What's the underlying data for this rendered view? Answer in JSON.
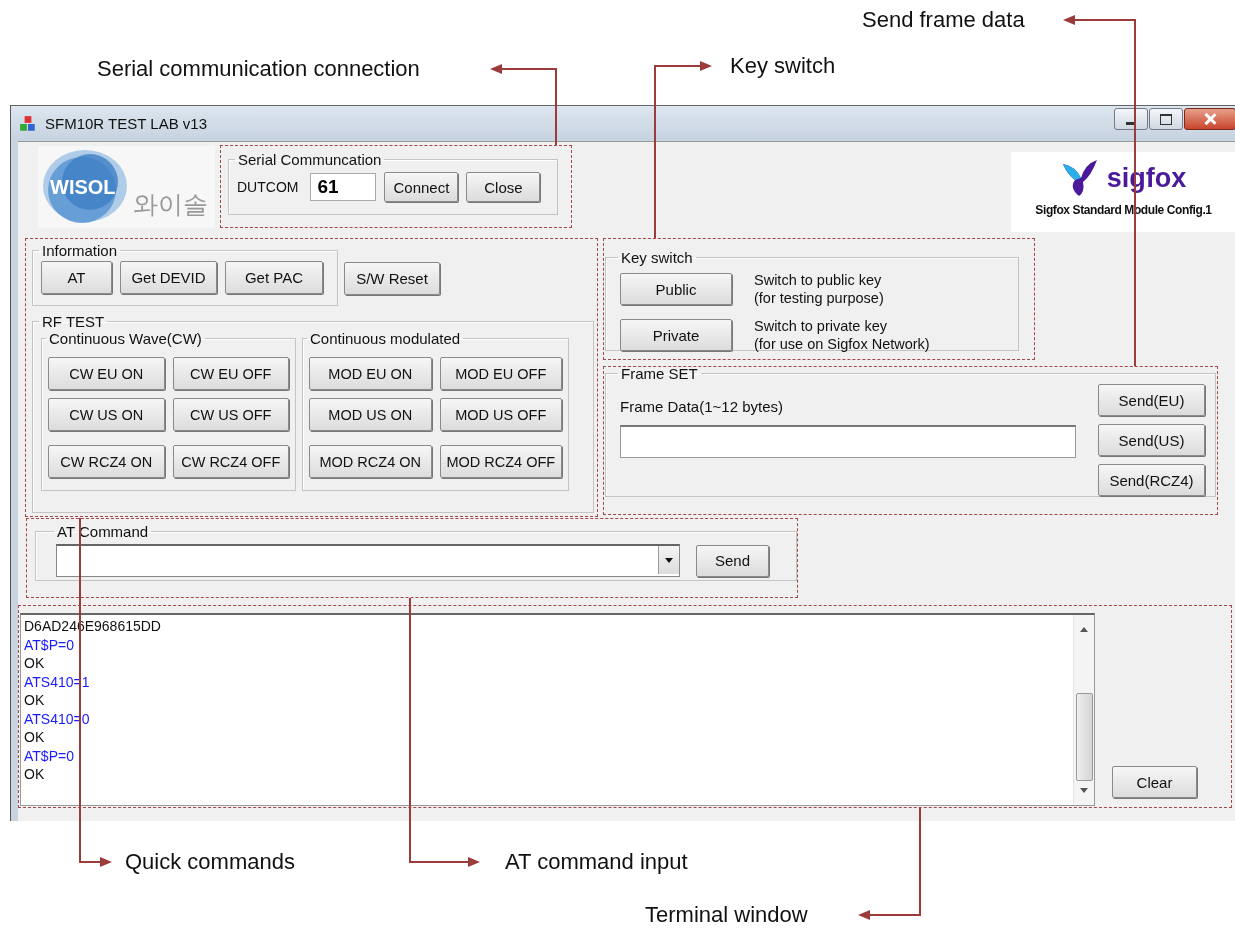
{
  "annotations": [
    {
      "kind": "serial",
      "label": "Serial communication connection"
    },
    {
      "kind": "key",
      "label": "Key switch"
    },
    {
      "kind": "frame",
      "label": "Send frame data"
    },
    {
      "kind": "quick",
      "label": "Quick commands"
    },
    {
      "kind": "at",
      "label": "AT command input"
    },
    {
      "kind": "terminal",
      "label": "Terminal window"
    }
  ],
  "window": {
    "title": "SFM10R TEST LAB v13"
  },
  "company_logo": {
    "text": "WISOL",
    "korean_text": "와이솔"
  },
  "serial": {
    "group_title": "Serial Communcation",
    "port_label": "DUTCOM",
    "port_value": "61",
    "buttons": [
      "Connect",
      "Close"
    ]
  },
  "sigfox_logo": {
    "text": "sigfox",
    "caption": "Sigfox Standard Module Config.1"
  },
  "information": {
    "group_title": "Information",
    "buttons": [
      "AT",
      "Get DEVID",
      "Get PAC"
    ]
  },
  "reset_button": "S/W Reset",
  "rf_test": {
    "group_title": "RF TEST",
    "groups": [
      {
        "title": "Continuous Wave(CW)",
        "buttons": [
          "CW EU ON",
          "CW EU OFF",
          "CW US ON",
          "CW US OFF",
          "CW RCZ4 ON",
          "CW RCZ4 OFF"
        ]
      },
      {
        "title": "Continuous modulated",
        "buttons": [
          "MOD EU ON",
          "MOD EU OFF",
          "MOD US ON",
          "MOD US OFF",
          "MOD RCZ4 ON",
          "MOD RCZ4 OFF"
        ]
      }
    ]
  },
  "key_switch": {
    "group_title": "Key switch",
    "rows": [
      {
        "button": "Public",
        "description": [
          "Switch to public key",
          "(for testing purpose)"
        ]
      },
      {
        "button": "Private",
        "description": [
          "Switch to private key",
          "(for use on Sigfox Network)"
        ]
      }
    ]
  },
  "frame_set": {
    "group_title": "Frame SET",
    "field_label": "Frame Data(1~12 bytes)",
    "buttons": [
      "Send(EU)",
      "Send(US)",
      "Send(RCZ4)"
    ]
  },
  "at_command": {
    "group_title": "AT Command",
    "button": "Send"
  },
  "terminal": {
    "lines": [
      {
        "kind": "response",
        "text": "D6AD246E968615DD"
      },
      {
        "kind": "command",
        "text": "AT$P=0"
      },
      {
        "kind": "response",
        "text": "OK"
      },
      {
        "kind": "command",
        "text": "ATS410=1"
      },
      {
        "kind": "response",
        "text": "OK"
      },
      {
        "kind": "command",
        "text": "ATS410=0"
      },
      {
        "kind": "response",
        "text": "OK"
      },
      {
        "kind": "command",
        "text": "AT$P=0"
      },
      {
        "kind": "response",
        "text": "OK"
      }
    ]
  },
  "clear_button": "Clear"
}
